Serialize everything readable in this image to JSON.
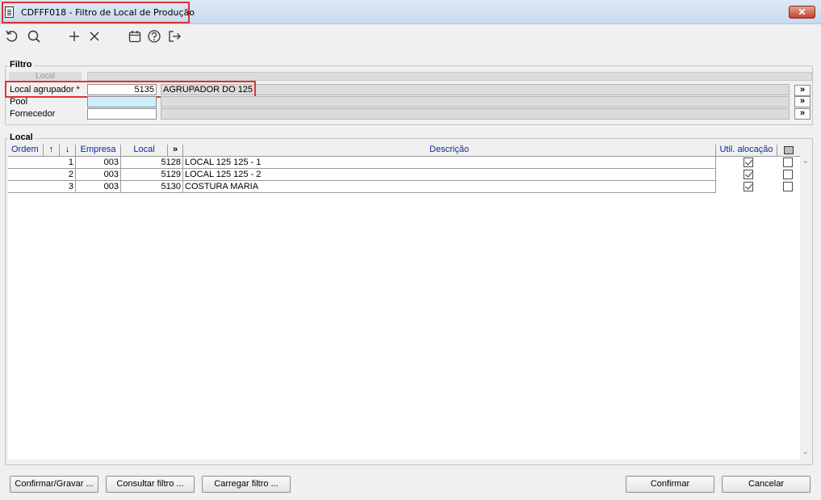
{
  "window": {
    "title": "CDFFF018 - Filtro de Local de Produção",
    "close_label": "✕"
  },
  "toolbar": {
    "buttons": [
      {
        "name": "refresh-icon"
      },
      {
        "name": "search-icon"
      },
      {
        "name": "add-icon"
      },
      {
        "name": "delete-icon"
      },
      {
        "name": "calendar-icon"
      },
      {
        "name": "help-icon"
      },
      {
        "name": "exit-icon"
      }
    ]
  },
  "filtro": {
    "legend": "Filtro",
    "local_label": "Local",
    "local_agrupador_label": "Local agrupador *",
    "local_agrupador_value": "5135",
    "local_agrupador_desc": "AGRUPADOR DO 125",
    "pool_label": "Pool",
    "pool_value": "",
    "fornecedor_label": "Fornecedor",
    "fornecedor_value": "",
    "more_label": "»"
  },
  "local_section": {
    "legend": "Local",
    "columns": {
      "ordem": "Ordem",
      "up": "↑",
      "down": "↓",
      "empresa": "Empresa",
      "local": "Local",
      "more": "»",
      "descricao": "Descrição",
      "util": "Util. alocação"
    },
    "rows": [
      {
        "ordem": "1",
        "empresa": "003",
        "local": "5128",
        "descricao": "LOCAL 125 125 - 1",
        "util": true,
        "sel": false
      },
      {
        "ordem": "2",
        "empresa": "003",
        "local": "5129",
        "descricao": "LOCAL 125 125 - 2",
        "util": true,
        "sel": false
      },
      {
        "ordem": "3",
        "empresa": "003",
        "local": "5130",
        "descricao": "COSTURA MARIA",
        "util": true,
        "sel": false
      }
    ]
  },
  "buttons": {
    "confirmar_gravar": "Confirmar/Gravar ...",
    "consultar_filtro": "Consultar filtro ...",
    "carregar_filtro": "Carregar filtro ...",
    "confirmar": "Confirmar",
    "cancelar": "Cancelar"
  },
  "colors": {
    "highlight": "#e23333",
    "header_text": "#0a2a9a",
    "pool_bg": "#cdeefc"
  }
}
